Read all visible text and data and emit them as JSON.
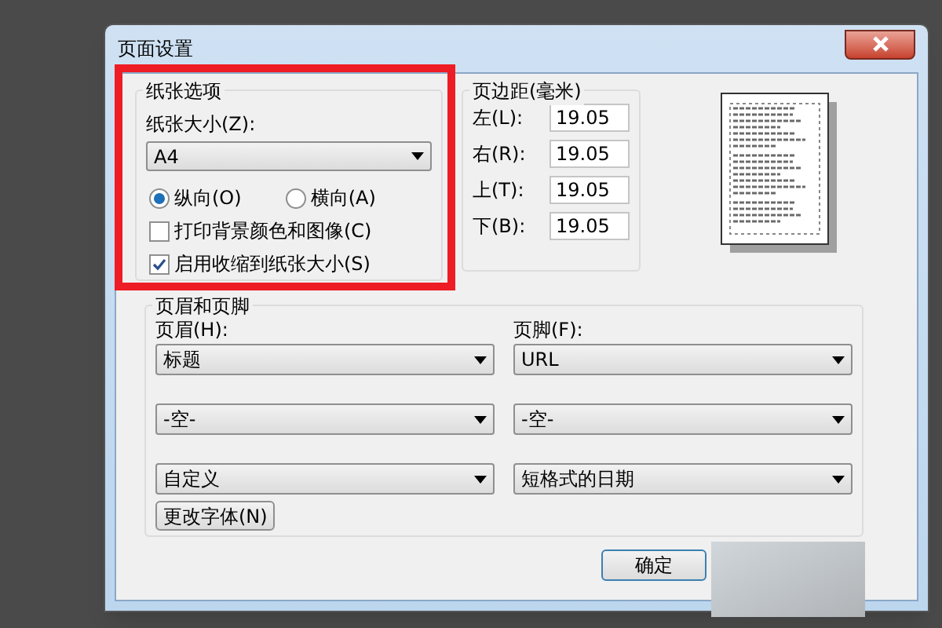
{
  "window": {
    "title": "页面设置"
  },
  "paper_options": {
    "title": "纸张选项",
    "size_label": "纸张大小(Z):",
    "size": "A4",
    "orientation": [
      {
        "label": "纵向(O)",
        "selected": true
      },
      {
        "label": "横向(A)",
        "selected": false
      }
    ],
    "checkboxes": [
      {
        "label": "打印背景颜色和图像(C)",
        "checked": false
      },
      {
        "label": "启用收缩到纸张大小(S)",
        "checked": true
      }
    ]
  },
  "margins": {
    "title": "页边距(毫米)",
    "fields": [
      {
        "label": "左(L):",
        "value": "19.05"
      },
      {
        "label": "右(R):",
        "value": "19.05"
      },
      {
        "label": "上(T):",
        "value": "19.05"
      },
      {
        "label": "下(B):",
        "value": "19.05"
      }
    ]
  },
  "header_footer": {
    "title": "页眉和页脚",
    "header_label": "页眉(H):",
    "footer_label": "页脚(F):",
    "header": [
      "标题",
      "-空-",
      "自定义"
    ],
    "footer": [
      "URL",
      "-空-",
      "短格式的日期"
    ],
    "font_button": "更改字体(N)"
  },
  "buttons": [
    "确定"
  ]
}
